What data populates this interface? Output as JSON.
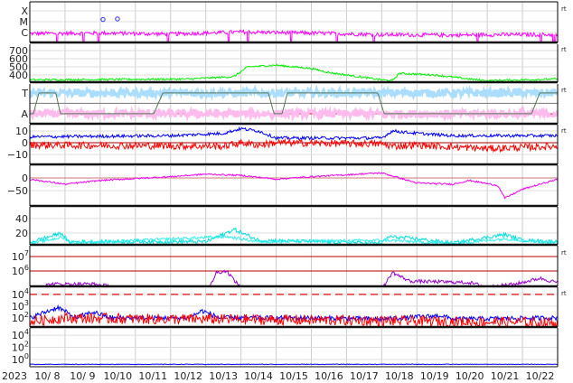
{
  "chart_data": {
    "type": "line",
    "title": "",
    "x_axis": {
      "year_label": "2023",
      "day_labels": [
        "10/ 8",
        "10/ 9",
        "10/10",
        "10/11",
        "10/12",
        "10/13",
        "10/14",
        "10/15",
        "10/16",
        "10/17",
        "10/18",
        "10/19",
        "10/20",
        "10/21",
        "10/22"
      ],
      "range_days": [
        0,
        15
      ]
    },
    "panels": [
      {
        "id": "xray",
        "ylim": [
          0.08,
          3.83
        ],
        "ticks": [
          {
            "v": 3,
            "label": "X"
          },
          {
            "v": 2,
            "label": "M"
          },
          {
            "v": 1,
            "label": "C"
          }
        ],
        "rt": "rt",
        "series": [
          {
            "name": "xray-flux",
            "color": "#ff00ff",
            "noise": 0.18,
            "spikes": true,
            "points": [
              [
                0,
                0.9
              ],
              [
                2,
                0.95
              ],
              [
                4,
                0.85
              ],
              [
                5.5,
                1.0
              ],
              [
                6,
                1.05
              ],
              [
                8,
                0.95
              ],
              [
                10,
                0.8
              ],
              [
                12,
                0.75
              ],
              [
                13,
                0.8
              ],
              [
                15,
                0.8
              ]
            ]
          }
        ],
        "markers": [
          {
            "x": 2.08,
            "y": 2.2,
            "color": "#3030ff"
          },
          {
            "x": 2.49,
            "y": 2.25,
            "color": "#3030ff"
          }
        ]
      },
      {
        "id": "speed",
        "ylim": [
          311,
          778
        ],
        "ticks": [
          {
            "v": 700,
            "label": "700"
          },
          {
            "v": 600,
            "label": "600"
          },
          {
            "v": 500,
            "label": "500"
          },
          {
            "v": 400,
            "label": "400"
          }
        ],
        "rt": "rt",
        "series": [
          {
            "name": "solar-wind-speed",
            "color": "#00ee00",
            "noise": 12,
            "points": [
              [
                0,
                340
              ],
              [
                4.5,
                350
              ],
              [
                5.8,
                380
              ],
              [
                6.2,
                500
              ],
              [
                7,
                520
              ],
              [
                8,
                480
              ],
              [
                8.5,
                430
              ],
              [
                10,
                340
              ],
              [
                10.3,
                330
              ],
              [
                10.5,
                420
              ],
              [
                11.5,
                400
              ],
              [
                12.5,
                350
              ],
              [
                13,
                330
              ],
              [
                15,
                350
              ]
            ]
          }
        ]
      },
      {
        "id": "polarity",
        "ylim": [
          -0.48,
          1.43
        ],
        "ticks": [
          {
            "v": 1,
            "label": "T"
          },
          {
            "v": 0,
            "label": "A"
          }
        ],
        "rt": "rt",
        "reflines": [
          {
            "v": 0.5,
            "color": "#777777"
          },
          {
            "v": 0,
            "color": "#cc2222"
          }
        ],
        "series": [
          {
            "name": "toward-points",
            "color": "#aaddff",
            "noise": 0.18,
            "width": 3,
            "points": [
              [
                0,
                1
              ],
              [
                15,
                1
              ]
            ]
          },
          {
            "name": "away-points",
            "color": "#ffbbee",
            "noise": 0.18,
            "width": 3,
            "points": [
              [
                0,
                0
              ],
              [
                15,
                0
              ]
            ]
          },
          {
            "name": "sector-step",
            "color": "#557755",
            "noise": 0,
            "points": [
              [
                0,
                0
              ],
              [
                0.1,
                0
              ],
              [
                0.26,
                1
              ],
              [
                0.74,
                1
              ],
              [
                0.87,
                0
              ],
              [
                3.52,
                0
              ],
              [
                3.78,
                1
              ],
              [
                6.78,
                1
              ],
              [
                6.94,
                0
              ],
              [
                7.17,
                0
              ],
              [
                7.32,
                1
              ],
              [
                9.89,
                1
              ],
              [
                10.07,
                0
              ],
              [
                14.26,
                0
              ],
              [
                14.49,
                1
              ],
              [
                15,
                1
              ]
            ]
          }
        ]
      },
      {
        "id": "imf",
        "ylim": [
          -18.5,
          15.4
        ],
        "ticks": [
          {
            "v": 10,
            "label": "10"
          },
          {
            "v": 0,
            "label": "0"
          },
          {
            "v": -10,
            "label": "−10"
          }
        ],
        "rt": "rt",
        "reflines": [
          {
            "v": 0,
            "color": "#aa0000"
          }
        ],
        "series": [
          {
            "name": "bt",
            "color": "#0000ff",
            "noise": 1.3,
            "points": [
              [
                0,
                5
              ],
              [
                4,
                6
              ],
              [
                5.5,
                8
              ],
              [
                6,
                12
              ],
              [
                6.5,
                10
              ],
              [
                7,
                4
              ],
              [
                10,
                4
              ],
              [
                10.3,
                10
              ],
              [
                11,
                8
              ],
              [
                12,
                6
              ],
              [
                13,
                6
              ],
              [
                15,
                6
              ]
            ]
          },
          {
            "name": "bz",
            "color": "#ff0000",
            "noise": 3,
            "points": [
              [
                0,
                -2
              ],
              [
                5.5,
                -3
              ],
              [
                6,
                0
              ],
              [
                6.5,
                -2
              ],
              [
                7,
                0
              ],
              [
                10,
                -1
              ],
              [
                10.3,
                -3
              ],
              [
                11,
                -2
              ],
              [
                13,
                -5
              ],
              [
                15,
                -3
              ]
            ]
          }
        ]
      },
      {
        "id": "dst",
        "ylim": [
          -111,
          50
        ],
        "ticks": [
          {
            "v": 0,
            "label": "0"
          },
          {
            "v": -50,
            "label": "−50"
          }
        ],
        "reflines": [
          {
            "v": 0,
            "color": "#cc7777"
          }
        ],
        "series": [
          {
            "name": "dst",
            "color": "#ee00ee",
            "noise": 3,
            "points": [
              [
                0,
                -5
              ],
              [
                1,
                -25
              ],
              [
                2,
                -10
              ],
              [
                4,
                5
              ],
              [
                5,
                15
              ],
              [
                6,
                10
              ],
              [
                7,
                -5
              ],
              [
                8,
                5
              ],
              [
                10,
                20
              ],
              [
                10.5,
                0
              ],
              [
                11,
                -20
              ],
              [
                12,
                -25
              ],
              [
                12.5,
                -10
              ],
              [
                13.3,
                -30
              ],
              [
                13.5,
                -80
              ],
              [
                14,
                -45
              ],
              [
                15,
                -5
              ]
            ]
          }
        ]
      },
      {
        "id": "density",
        "ylim": [
          3.75,
          56
        ],
        "ticks": [
          {
            "v": 40,
            "label": "40"
          },
          {
            "v": 20,
            "label": "20"
          }
        ],
        "series": [
          {
            "name": "density-a",
            "color": "#00dddd",
            "noise": 2.5,
            "points": [
              [
                0,
                7
              ],
              [
                0.9,
                20
              ],
              [
                1.1,
                8
              ],
              [
                5,
                8
              ],
              [
                5.5,
                18
              ],
              [
                5.8,
                25
              ],
              [
                6.5,
                10
              ],
              [
                10,
                6
              ],
              [
                10.2,
                15
              ],
              [
                11,
                12
              ],
              [
                12,
                6
              ],
              [
                13.5,
                18
              ],
              [
                14,
                10
              ],
              [
                15,
                8
              ]
            ]
          },
          {
            "name": "density-b",
            "color": "#33eeee",
            "noise": 2,
            "points": [
              [
                0,
                5
              ],
              [
                0.9,
                14
              ],
              [
                1.2,
                6
              ],
              [
                5.6,
                15
              ],
              [
                6.5,
                8
              ],
              [
                10.2,
                10
              ],
              [
                12,
                5
              ],
              [
                13.5,
                12
              ],
              [
                15,
                6
              ]
            ]
          }
        ]
      },
      {
        "id": "electron-flux",
        "log": true,
        "ylim": [
          4.94,
          7.75
        ],
        "ticks": [
          {
            "v": 7,
            "label": "10",
            "exp": "7"
          },
          {
            "v": 6,
            "label": "10",
            "exp": "6"
          }
        ],
        "rt": "rt",
        "reflines": [
          {
            "v": 7,
            "color": "#bb0000"
          },
          {
            "v": 6,
            "color": "#bb0000"
          }
        ],
        "series": [
          {
            "name": "electron-flux",
            "color": "#9900cc",
            "noise": 0.12,
            "points": [
              [
                0,
                4.7
              ],
              [
                0.6,
                5.1
              ],
              [
                1.8,
                5.1
              ],
              [
                3,
                4.7
              ],
              [
                5.1,
                4.8
              ],
              [
                5.3,
                5.9
              ],
              [
                5.6,
                6.0
              ],
              [
                5.9,
                5.1
              ],
              [
                6.2,
                4.7
              ],
              [
                10,
                4.7
              ],
              [
                10.3,
                5.9
              ],
              [
                10.8,
                5.3
              ],
              [
                12.5,
                5.2
              ],
              [
                13,
                4.9
              ],
              [
                13.8,
                5.1
              ],
              [
                14.5,
                5.5
              ],
              [
                15,
                5.2
              ]
            ]
          }
        ]
      },
      {
        "id": "proton-flux",
        "log": true,
        "ylim": [
          1.23,
          4.6
        ],
        "ticks": [
          {
            "v": 4,
            "label": "10",
            "exp": "4"
          },
          {
            "v": 3,
            "label": "10",
            "exp": "3"
          },
          {
            "v": 2,
            "label": "10",
            "exp": "2"
          }
        ],
        "rt": "rt",
        "reflines": [
          {
            "v": 4,
            "color": "#dd3333",
            "dashed": true
          }
        ],
        "series": [
          {
            "name": "proton-blue",
            "color": "#0000ff",
            "noise": 0.2,
            "points": [
              [
                0,
                2.0
              ],
              [
                0.8,
                2.9
              ],
              [
                1.3,
                2.0
              ],
              [
                1.8,
                2.5
              ],
              [
                2.3,
                2.0
              ],
              [
                4.5,
                2.0
              ],
              [
                4.9,
                2.6
              ],
              [
                5.4,
                2.0
              ],
              [
                8,
                2.0
              ],
              [
                10,
                1.9
              ],
              [
                11.7,
                2.2
              ],
              [
                12,
                1.9
              ],
              [
                15,
                2.0
              ]
            ]
          },
          {
            "name": "proton-red",
            "color": "#ff0000",
            "noise": 0.45,
            "points": [
              [
                0,
                1.7
              ],
              [
                1,
                2.0
              ],
              [
                3.5,
                1.9
              ],
              [
                5,
                1.9
              ],
              [
                15,
                1.6
              ]
            ]
          }
        ]
      },
      {
        "id": "high-energy",
        "log": true,
        "ylim": [
          -1.2,
          5.2
        ],
        "ticks": [
          {
            "v": 4,
            "label": "10",
            "exp": "4"
          },
          {
            "v": 2,
            "label": "10",
            "exp": "2"
          },
          {
            "v": 0,
            "label": "10",
            "exp": "0"
          }
        ],
        "series": [
          {
            "name": "high-energy-flux",
            "color": "#0000ff",
            "noise": 0.05,
            "points": [
              [
                0,
                -0.8
              ],
              [
                15,
                -0.8
              ]
            ]
          }
        ]
      }
    ]
  }
}
